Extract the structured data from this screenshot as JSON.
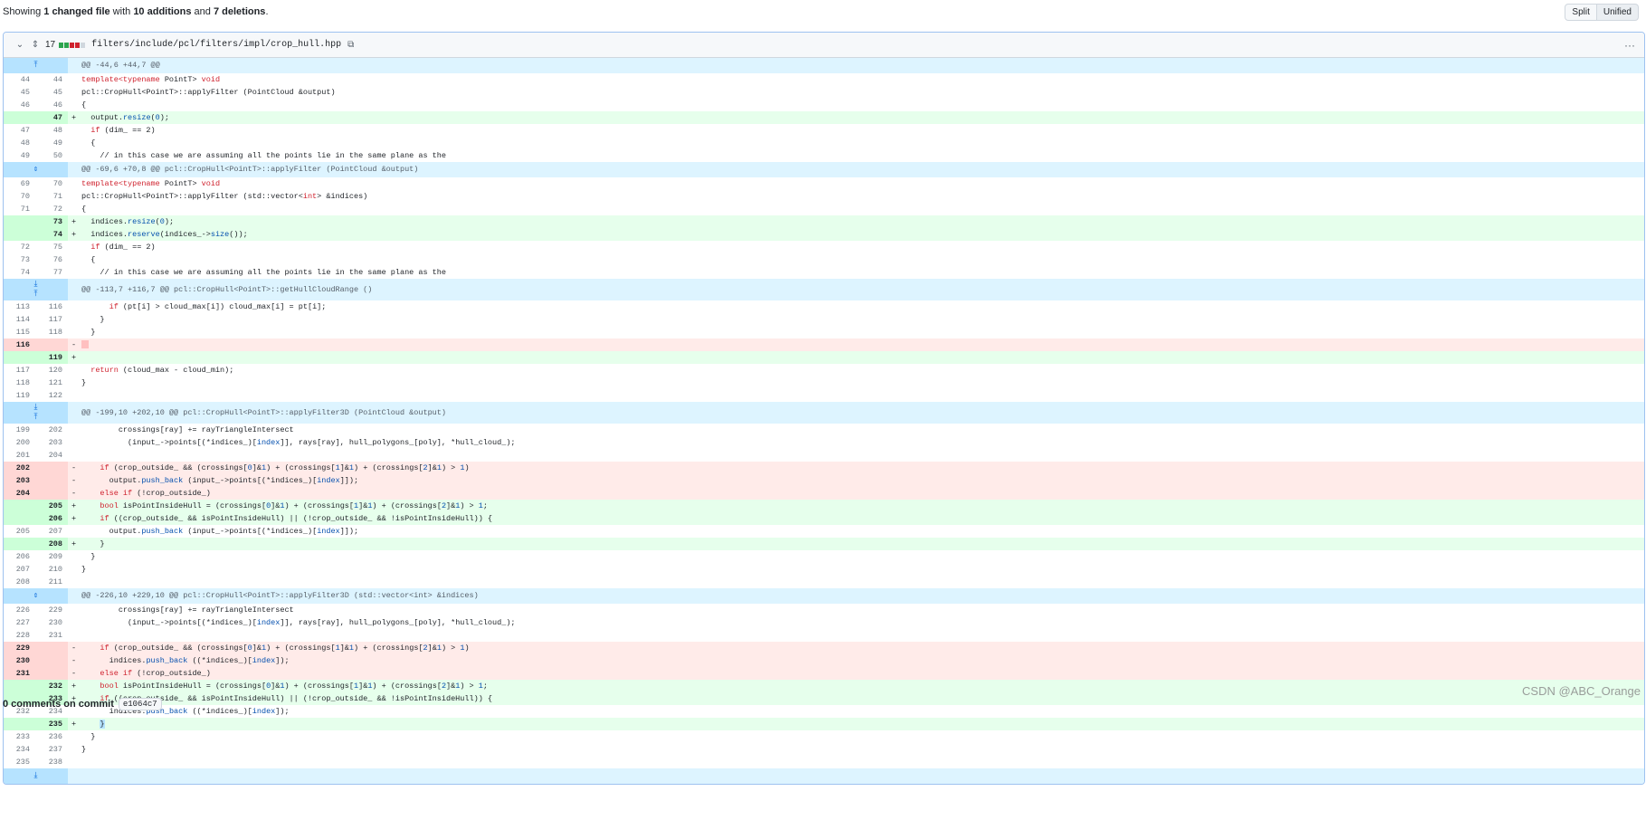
{
  "summary": {
    "pre": "Showing ",
    "files": "1 changed file",
    "mid": " with ",
    "adds": "10 additions",
    "and": " and ",
    "dels": "7 deletions",
    "end": "."
  },
  "view_toggle": {
    "split": "Split",
    "unified": "Unified"
  },
  "file": {
    "changes": "17",
    "path": "filters/include/pcl/filters/impl/crop_hull.hpp",
    "menu": "···",
    "icons": {
      "collapse": "chevron-down-icon",
      "expand": "expand-icon",
      "copy": "copy-icon"
    },
    "bar_colors": [
      "#2da44e",
      "#2da44e",
      "#cf222e",
      "#cf222e",
      "#d0d7de"
    ]
  },
  "rows": [
    {
      "t": "hunk",
      "exp": "⤒",
      "text": "@@ -44,6 +44,7 @@"
    },
    {
      "t": "ctx",
      "o": "44",
      "n": "44",
      "s": "",
      "c": [
        [
          "k",
          "template<typename"
        ],
        [
          "",
          " PointT> "
        ],
        [
          "k",
          "void"
        ]
      ]
    },
    {
      "t": "ctx",
      "o": "45",
      "n": "45",
      "s": "",
      "c": [
        [
          "",
          "pcl::CropHull<PointT>::applyFilter (PointCloud &output)"
        ]
      ]
    },
    {
      "t": "ctx",
      "o": "46",
      "n": "46",
      "s": "",
      "c": [
        [
          "",
          "{"
        ]
      ]
    },
    {
      "t": "add",
      "o": "",
      "n": "47",
      "s": "+",
      "c": [
        [
          "",
          "  output."
        ],
        [
          "f",
          "resize"
        ],
        [
          "",
          "("
        ],
        [
          "f",
          "0"
        ],
        [
          "",
          ");"
        ]
      ]
    },
    {
      "t": "ctx",
      "o": "47",
      "n": "48",
      "s": "",
      "c": [
        [
          "",
          "  "
        ],
        [
          "k",
          "if"
        ],
        [
          "",
          " (dim_ == 2)"
        ]
      ]
    },
    {
      "t": "ctx",
      "o": "48",
      "n": "49",
      "s": "",
      "c": [
        [
          "",
          "  {"
        ]
      ]
    },
    {
      "t": "ctx",
      "o": "49",
      "n": "50",
      "s": "",
      "c": [
        [
          "",
          "    // in this case we are assuming all the points lie in the same plane as the"
        ]
      ]
    },
    {
      "t": "hunk",
      "exp": "⇕",
      "text": "@@ -69,6 +70,8 @@ pcl::CropHull<PointT>::applyFilter (PointCloud &output)"
    },
    {
      "t": "ctx",
      "o": "69",
      "n": "70",
      "s": "",
      "c": [
        [
          "k",
          "template<typename"
        ],
        [
          "",
          " PointT> "
        ],
        [
          "k",
          "void"
        ]
      ]
    },
    {
      "t": "ctx",
      "o": "70",
      "n": "71",
      "s": "",
      "c": [
        [
          "",
          "pcl::CropHull<PointT>::applyFilter (std::vector<"
        ],
        [
          "k",
          "int"
        ],
        [
          "",
          "> &indices)"
        ]
      ]
    },
    {
      "t": "ctx",
      "o": "71",
      "n": "72",
      "s": "",
      "c": [
        [
          "",
          "{"
        ]
      ]
    },
    {
      "t": "add",
      "o": "",
      "n": "73",
      "s": "+",
      "c": [
        [
          "",
          "  indices."
        ],
        [
          "f",
          "resize"
        ],
        [
          "",
          "("
        ],
        [
          "f",
          "0"
        ],
        [
          "",
          ");"
        ]
      ]
    },
    {
      "t": "add",
      "o": "",
      "n": "74",
      "s": "+",
      "c": [
        [
          "",
          "  indices."
        ],
        [
          "f",
          "reserve"
        ],
        [
          "",
          "(indices_->"
        ],
        [
          "f",
          "size"
        ],
        [
          "",
          "());"
        ]
      ]
    },
    {
      "t": "ctx",
      "o": "72",
      "n": "75",
      "s": "",
      "c": [
        [
          "",
          "  "
        ],
        [
          "k",
          "if"
        ],
        [
          "",
          " (dim_ == 2)"
        ]
      ]
    },
    {
      "t": "ctx",
      "o": "73",
      "n": "76",
      "s": "",
      "c": [
        [
          "",
          "  {"
        ]
      ]
    },
    {
      "t": "ctx",
      "o": "74",
      "n": "77",
      "s": "",
      "c": [
        [
          "",
          "    // in this case we are assuming all the points lie in the same plane as the"
        ]
      ]
    },
    {
      "t": "hunk",
      "tall": true,
      "exp": "⤓\n⤒",
      "text": "@@ -113,7 +116,7 @@ pcl::CropHull<PointT>::getHullCloudRange ()"
    },
    {
      "t": "ctx",
      "o": "113",
      "n": "116",
      "s": "",
      "c": [
        [
          "",
          "      "
        ],
        [
          "k",
          "if"
        ],
        [
          "",
          " (pt[i] > cloud_max[i]) cloud_max[i] = pt[i];"
        ]
      ]
    },
    {
      "t": "ctx",
      "o": "114",
      "n": "117",
      "s": "",
      "c": [
        [
          "",
          "    }"
        ]
      ]
    },
    {
      "t": "ctx",
      "o": "115",
      "n": "118",
      "s": "",
      "c": [
        [
          "",
          "  }"
        ]
      ]
    },
    {
      "t": "del",
      "o": "116",
      "n": "",
      "s": "-",
      "c": [
        [
          "hl",
          " "
        ]
      ]
    },
    {
      "t": "add",
      "o": "",
      "n": "119",
      "s": "+",
      "c": [
        [
          "",
          ""
        ]
      ]
    },
    {
      "t": "ctx",
      "o": "117",
      "n": "120",
      "s": "",
      "c": [
        [
          "",
          "  "
        ],
        [
          "k",
          "return"
        ],
        [
          "",
          " (cloud_max - cloud_min);"
        ]
      ]
    },
    {
      "t": "ctx",
      "o": "118",
      "n": "121",
      "s": "",
      "c": [
        [
          "",
          "}"
        ]
      ]
    },
    {
      "t": "ctx",
      "o": "119",
      "n": "122",
      "s": "",
      "c": [
        [
          "",
          ""
        ]
      ]
    },
    {
      "t": "hunk",
      "tall": true,
      "exp": "⤓\n⤒",
      "text": "@@ -199,10 +202,10 @@ pcl::CropHull<PointT>::applyFilter3D (PointCloud &output)"
    },
    {
      "t": "ctx",
      "o": "199",
      "n": "202",
      "s": "",
      "c": [
        [
          "",
          "        crossings[ray] += rayTriangleIntersect"
        ]
      ]
    },
    {
      "t": "ctx",
      "o": "200",
      "n": "203",
      "s": "",
      "c": [
        [
          "",
          "          (input_->points[(*indices_)["
        ],
        [
          "f",
          "index"
        ],
        [
          "",
          "]], rays[ray], hull_polygons_[poly], *hull_cloud_);"
        ]
      ]
    },
    {
      "t": "ctx",
      "o": "201",
      "n": "204",
      "s": "",
      "c": [
        [
          "",
          ""
        ]
      ]
    },
    {
      "t": "del",
      "o": "202",
      "n": "",
      "s": "-",
      "c": [
        [
          "",
          "    "
        ],
        [
          "k",
          "if"
        ],
        [
          "",
          " (crop_outside_ && (crossings["
        ],
        [
          "f",
          "0"
        ],
        [
          "",
          "]&"
        ],
        [
          "f",
          "1"
        ],
        [
          "",
          ") + (crossings["
        ],
        [
          "f",
          "1"
        ],
        [
          "",
          "]&"
        ],
        [
          "f",
          "1"
        ],
        [
          "",
          ") + (crossings["
        ],
        [
          "f",
          "2"
        ],
        [
          "",
          "]&"
        ],
        [
          "f",
          "1"
        ],
        [
          "",
          ") > "
        ],
        [
          "f",
          "1"
        ],
        [
          "",
          ")"
        ]
      ]
    },
    {
      "t": "del",
      "o": "203",
      "n": "",
      "s": "-",
      "c": [
        [
          "",
          "      output."
        ],
        [
          "f",
          "push_back"
        ],
        [
          "",
          " (input_->points[(*indices_)["
        ],
        [
          "f",
          "index"
        ],
        [
          "",
          "]]);"
        ]
      ]
    },
    {
      "t": "del",
      "o": "204",
      "n": "",
      "s": "-",
      "c": [
        [
          "",
          "    "
        ],
        [
          "k",
          "else if"
        ],
        [
          "",
          " (!crop_outside_)"
        ]
      ]
    },
    {
      "t": "add",
      "o": "",
      "n": "205",
      "s": "+",
      "c": [
        [
          "",
          "    "
        ],
        [
          "k",
          "bool"
        ],
        [
          "",
          " isPointInsideHull = (crossings["
        ],
        [
          "f",
          "0"
        ],
        [
          "",
          "]&"
        ],
        [
          "f",
          "1"
        ],
        [
          "",
          ") + (crossings["
        ],
        [
          "f",
          "1"
        ],
        [
          "",
          "]&"
        ],
        [
          "f",
          "1"
        ],
        [
          "",
          ") + (crossings["
        ],
        [
          "f",
          "2"
        ],
        [
          "",
          "]&"
        ],
        [
          "f",
          "1"
        ],
        [
          "",
          ") > "
        ],
        [
          "f",
          "1"
        ],
        [
          "",
          ";"
        ]
      ]
    },
    {
      "t": "add",
      "o": "",
      "n": "206",
      "s": "+",
      "c": [
        [
          "",
          "    "
        ],
        [
          "k",
          "if"
        ],
        [
          "",
          " ((crop_outside_ && isPointInsideHull) || (!crop_outside_ && !isPointInsideHull)) {"
        ]
      ]
    },
    {
      "t": "ctx",
      "o": "205",
      "n": "207",
      "s": "",
      "c": [
        [
          "",
          "      output."
        ],
        [
          "f",
          "push_back"
        ],
        [
          "",
          " (input_->points[(*indices_)["
        ],
        [
          "f",
          "index"
        ],
        [
          "",
          "]]);"
        ]
      ]
    },
    {
      "t": "add",
      "o": "",
      "n": "208",
      "s": "+",
      "c": [
        [
          "",
          "    }"
        ]
      ]
    },
    {
      "t": "ctx",
      "o": "206",
      "n": "209",
      "s": "",
      "c": [
        [
          "",
          "  }"
        ]
      ]
    },
    {
      "t": "ctx",
      "o": "207",
      "n": "210",
      "s": "",
      "c": [
        [
          "",
          "}"
        ]
      ]
    },
    {
      "t": "ctx",
      "o": "208",
      "n": "211",
      "s": "",
      "c": [
        [
          "",
          ""
        ]
      ]
    },
    {
      "t": "hunk",
      "exp": "⇕",
      "text": "@@ -226,10 +229,10 @@ pcl::CropHull<PointT>::applyFilter3D (std::vector<int> &indices)"
    },
    {
      "t": "ctx",
      "o": "226",
      "n": "229",
      "s": "",
      "c": [
        [
          "",
          "        crossings[ray] += rayTriangleIntersect"
        ]
      ]
    },
    {
      "t": "ctx",
      "o": "227",
      "n": "230",
      "s": "",
      "c": [
        [
          "",
          "          (input_->points[(*indices_)["
        ],
        [
          "f",
          "index"
        ],
        [
          "",
          "]], rays[ray], hull_polygons_[poly], *hull_cloud_);"
        ]
      ]
    },
    {
      "t": "ctx",
      "o": "228",
      "n": "231",
      "s": "",
      "c": [
        [
          "",
          ""
        ]
      ]
    },
    {
      "t": "del",
      "o": "229",
      "n": "",
      "s": "-",
      "c": [
        [
          "",
          "    "
        ],
        [
          "k",
          "if"
        ],
        [
          "",
          " (crop_outside_ && (crossings["
        ],
        [
          "f",
          "0"
        ],
        [
          "",
          "]&"
        ],
        [
          "f",
          "1"
        ],
        [
          "",
          ") + (crossings["
        ],
        [
          "f",
          "1"
        ],
        [
          "",
          "]&"
        ],
        [
          "f",
          "1"
        ],
        [
          "",
          ") + (crossings["
        ],
        [
          "f",
          "2"
        ],
        [
          "",
          "]&"
        ],
        [
          "f",
          "1"
        ],
        [
          "",
          ") > "
        ],
        [
          "f",
          "1"
        ],
        [
          "",
          ")"
        ]
      ]
    },
    {
      "t": "del",
      "o": "230",
      "n": "",
      "s": "-",
      "c": [
        [
          "",
          "      indices."
        ],
        [
          "f",
          "push_back"
        ],
        [
          "",
          " ((*indices_)["
        ],
        [
          "f",
          "index"
        ],
        [
          "",
          "]);"
        ]
      ]
    },
    {
      "t": "del",
      "o": "231",
      "n": "",
      "s": "-",
      "c": [
        [
          "",
          "    "
        ],
        [
          "k",
          "else if"
        ],
        [
          "",
          " (!crop_outside_)"
        ]
      ]
    },
    {
      "t": "add",
      "o": "",
      "n": "232",
      "s": "+",
      "c": [
        [
          "",
          "    "
        ],
        [
          "k",
          "bool"
        ],
        [
          "",
          " isPointInsideHull = (crossings["
        ],
        [
          "f",
          "0"
        ],
        [
          "",
          "]&"
        ],
        [
          "f",
          "1"
        ],
        [
          "",
          ") + (crossings["
        ],
        [
          "f",
          "1"
        ],
        [
          "",
          "]&"
        ],
        [
          "f",
          "1"
        ],
        [
          "",
          ") + (crossings["
        ],
        [
          "f",
          "2"
        ],
        [
          "",
          "]&"
        ],
        [
          "f",
          "1"
        ],
        [
          "",
          ") > "
        ],
        [
          "f",
          "1"
        ],
        [
          "",
          ";"
        ]
      ]
    },
    {
      "t": "add",
      "o": "",
      "n": "233",
      "s": "+",
      "c": [
        [
          "",
          "    "
        ],
        [
          "k",
          "if"
        ],
        [
          "",
          " ((crop_outside_ && isPointInsideHull) || (!crop_outside_ && !isPointInsideHull)) {"
        ]
      ]
    },
    {
      "t": "ctx",
      "o": "232",
      "n": "234",
      "s": "",
      "c": [
        [
          "",
          "      indices."
        ],
        [
          "f",
          "push_back"
        ],
        [
          "",
          " ((*indices_)["
        ],
        [
          "f",
          "index"
        ],
        [
          "",
          "]);"
        ]
      ]
    },
    {
      "t": "add",
      "o": "",
      "n": "235",
      "s": "+",
      "c": [
        [
          "",
          "    "
        ],
        [
          "sel",
          "}"
        ]
      ]
    },
    {
      "t": "ctx",
      "o": "233",
      "n": "236",
      "s": "",
      "c": [
        [
          "",
          "  }"
        ]
      ]
    },
    {
      "t": "ctx",
      "o": "234",
      "n": "237",
      "s": "",
      "c": [
        [
          "",
          "}"
        ]
      ]
    },
    {
      "t": "ctx",
      "o": "235",
      "n": "238",
      "s": "",
      "c": [
        [
          "",
          ""
        ]
      ]
    },
    {
      "t": "hunk",
      "exp": "⤓",
      "text": ""
    }
  ],
  "footer": {
    "comments": "0 comments on commit",
    "sha": "e1064c7"
  },
  "watermark": "CSDN @ABC_Orange"
}
